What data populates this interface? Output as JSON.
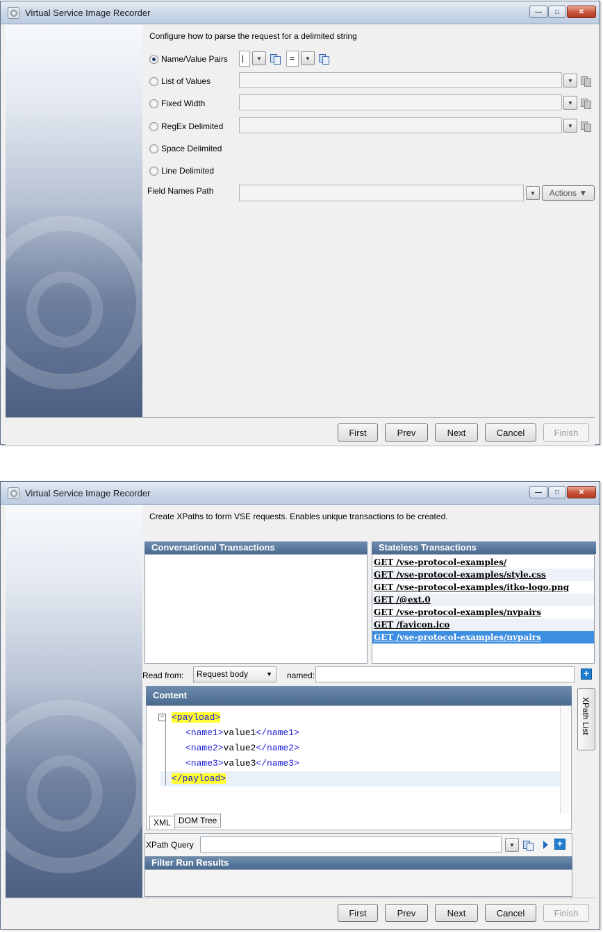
{
  "window1": {
    "title": "Virtual Service Image Recorder",
    "instruction": "Configure how to parse the request for a delimited string",
    "options": [
      {
        "label": "Name/Value Pairs",
        "selected": true
      },
      {
        "label": "List of Values",
        "selected": false
      },
      {
        "label": "Fixed Width",
        "selected": false
      },
      {
        "label": "RegEx Delimited",
        "selected": false
      },
      {
        "label": "Space Delimited",
        "selected": false
      },
      {
        "label": "Line Delimited",
        "selected": false
      }
    ],
    "pair_delimiter": "|",
    "value_delimiter": "=",
    "field_names_path_label": "Field Names Path",
    "actions_label": "Actions",
    "buttons": {
      "first": "First",
      "prev": "Prev",
      "next": "Next",
      "cancel": "Cancel",
      "finish": "Finish"
    }
  },
  "window2": {
    "title": "Virtual Service Image Recorder",
    "instruction": "Create XPaths to form VSE requests.  Enables unique transactions to be created.",
    "conversational_header": "Conversational Transactions",
    "stateless_header": "Stateless Transactions",
    "stateless_items": [
      "GET /vse-protocol-examples/",
      "GET /vse-protocol-examples/style.css",
      "GET /vse-protocol-examples/itko-logo.png",
      "GET /@ext.0",
      "GET /vse-protocol-examples/nvpairs",
      "GET /favicon.ico",
      "GET /vse-protocol-examples/nvpairs"
    ],
    "selected_index": 6,
    "read_from_label": "Read from:",
    "read_from_value": "Request body",
    "named_label": "named:",
    "content_header": "Content",
    "xpath_list_tab": "XPath List",
    "xml": {
      "open": "<payload>",
      "lines": [
        {
          "open": "<name1>",
          "value": "value1",
          "close": "</name1>"
        },
        {
          "open": "<name2>",
          "value": "value2",
          "close": "</name2>"
        },
        {
          "open": "<name3>",
          "value": "value3",
          "close": "</name3>"
        }
      ],
      "close": "</payload>"
    },
    "tabs": [
      "XML",
      "DOM Tree"
    ],
    "xpath_query_label": "XPath Query",
    "filter_results_header": "Filter Run Results",
    "buttons": {
      "first": "First",
      "prev": "Prev",
      "next": "Next",
      "cancel": "Cancel",
      "finish": "Finish"
    }
  },
  "colors": {
    "panel_header": "#4a6a91",
    "selected_row": "#3c8ee2",
    "xml_tag": "#1a1ad6",
    "xml_highlight": "#ffff33"
  }
}
